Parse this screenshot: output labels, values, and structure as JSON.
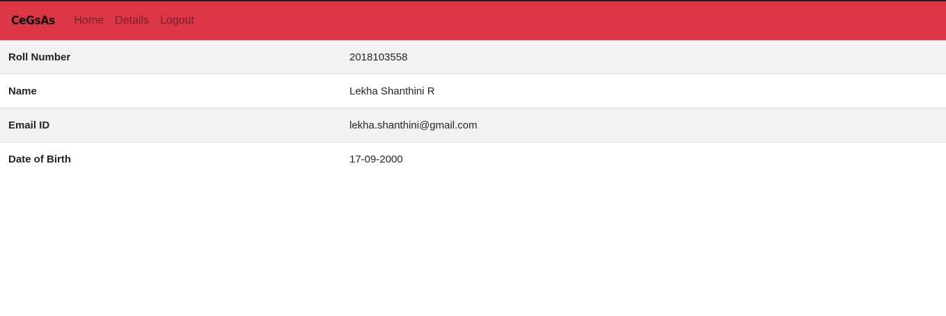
{
  "navbar": {
    "brand": "CeGsAs",
    "links": [
      "Home",
      "Details",
      "Logout"
    ],
    "background_color": "#dc3545"
  },
  "details": {
    "rows": [
      {
        "label": "Roll Number",
        "value": "2018103558"
      },
      {
        "label": "Name",
        "value": "Lekha Shanthini R"
      },
      {
        "label": "Email ID",
        "value": "lekha.shanthini@gmail.com"
      },
      {
        "label": "Date of Birth",
        "value": "17-09-2000"
      }
    ]
  }
}
